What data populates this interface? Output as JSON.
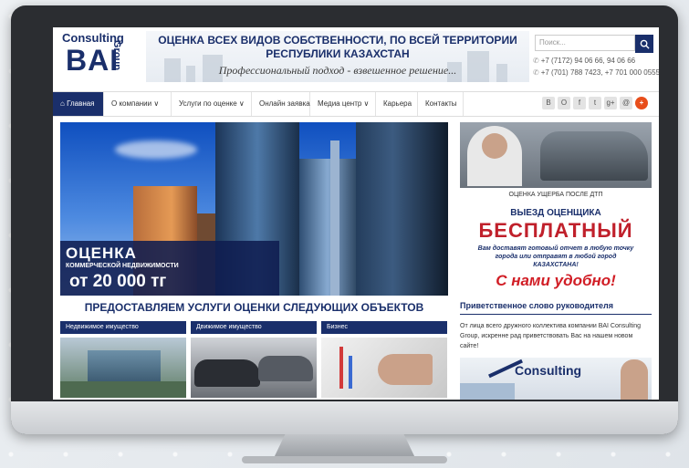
{
  "header": {
    "logo": {
      "top": "Consulting",
      "main": "BAI",
      "side": "Group"
    },
    "banner": {
      "line1": "ОЦЕНКА ВСЕХ ВИДОВ СОБСТВЕННОСТИ, ПО ВСЕЙ ТЕРРИТОРИИ",
      "line2": "РЕСПУБЛИКИ КАЗАХСТАН",
      "slogan": "Профессиональный подход - взвешенное решение..."
    },
    "search": {
      "placeholder": "Поиск..."
    },
    "phones": [
      "+7 (7172) 94 06 66, 94 06 66",
      "+7 (701) 788 7423, +7 701 000 0555"
    ]
  },
  "nav": {
    "items": [
      "Главная",
      "О компании ∨",
      "Услуги по оценке ∨",
      "Онлайн заявка",
      "Медиа центр ∨",
      "Карьера",
      "Контакты"
    ],
    "social": [
      "В",
      "О",
      "f",
      "t",
      "g+",
      "@"
    ],
    "plus": "+"
  },
  "hero": {
    "line1": "ОЦЕНКА",
    "line2": "КОММЕРЧЕСКОЙ НЕДВИЖИМОСТИ",
    "price": "от 20 000 тг"
  },
  "ads": {
    "damage_caption": "ОЦЕНКА УЩЕРБА ПОСЛЕ ДТП",
    "promo": {
      "line1": "ВЫЕЗД ОЦЕНЩИКА",
      "line2": "БЕСПЛАТНЫЙ",
      "line3": "Вам доставят готовый отчет в любую точку города или отправят в любой город КАЗАХСТАНА!",
      "line4": "С нами удобно!"
    }
  },
  "services": {
    "title": "ПРЕДОСТАВЛЯЕМ УСЛУГИ ОЦЕНКИ СЛЕДУЮЩИХ ОБЪЕКТОВ",
    "tabs": [
      "Недвижимое имущество",
      "Движимое имущество",
      "Бизнес"
    ]
  },
  "ceo": {
    "title": "Приветственное слово руководителя",
    "text": "От лица всего дружного коллектива компании BAI Consulting Group, искренне рад приветствовать Вас на нашем новом сайте!",
    "image_text": "Consulting"
  },
  "colors": {
    "brand": "#1a2f6b",
    "accent_red": "#c0202b",
    "plus": "#e84e1b"
  }
}
